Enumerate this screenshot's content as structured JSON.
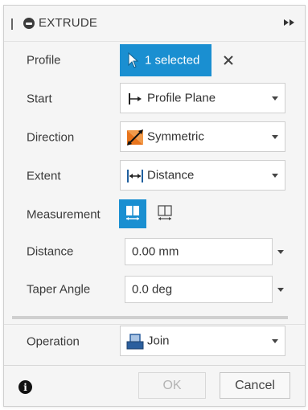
{
  "dialog": {
    "title": "EXTRUDE"
  },
  "fields": {
    "profile": {
      "label": "Profile",
      "selection_text": "1 selected"
    },
    "start": {
      "label": "Start",
      "value": "Profile Plane"
    },
    "direction": {
      "label": "Direction",
      "value": "Symmetric"
    },
    "extent": {
      "label": "Extent",
      "value": "Distance"
    },
    "measurement": {
      "label": "Measurement"
    },
    "distance": {
      "label": "Distance",
      "value": "0.00 mm"
    },
    "taper_angle": {
      "label": "Taper Angle",
      "value": "0.0 deg"
    },
    "operation": {
      "label": "Operation",
      "value": "Join"
    }
  },
  "footer": {
    "info_glyph": "i",
    "ok_label": "OK",
    "cancel_label": "Cancel"
  },
  "colors": {
    "accent": "#1a8fd1",
    "panel_bg": "#f5f5f5",
    "symmetric_icon": "#e8741c",
    "join_icon": "#2b5f9e"
  }
}
